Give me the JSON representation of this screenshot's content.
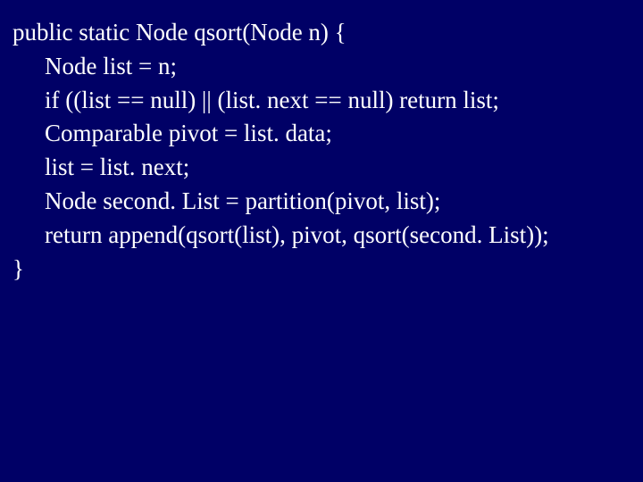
{
  "code": {
    "line1": "public static Node qsort(Node n) {",
    "line2": "Node list = n;",
    "line3": "if ((list == null) || (list. next == null) return list;",
    "line4": "Comparable pivot = list. data;",
    "line5": "list = list. next;",
    "line6": "Node second. List = partition(pivot, list);",
    "line7": "return append(qsort(list), pivot, qsort(second. List));",
    "line8": "}"
  }
}
